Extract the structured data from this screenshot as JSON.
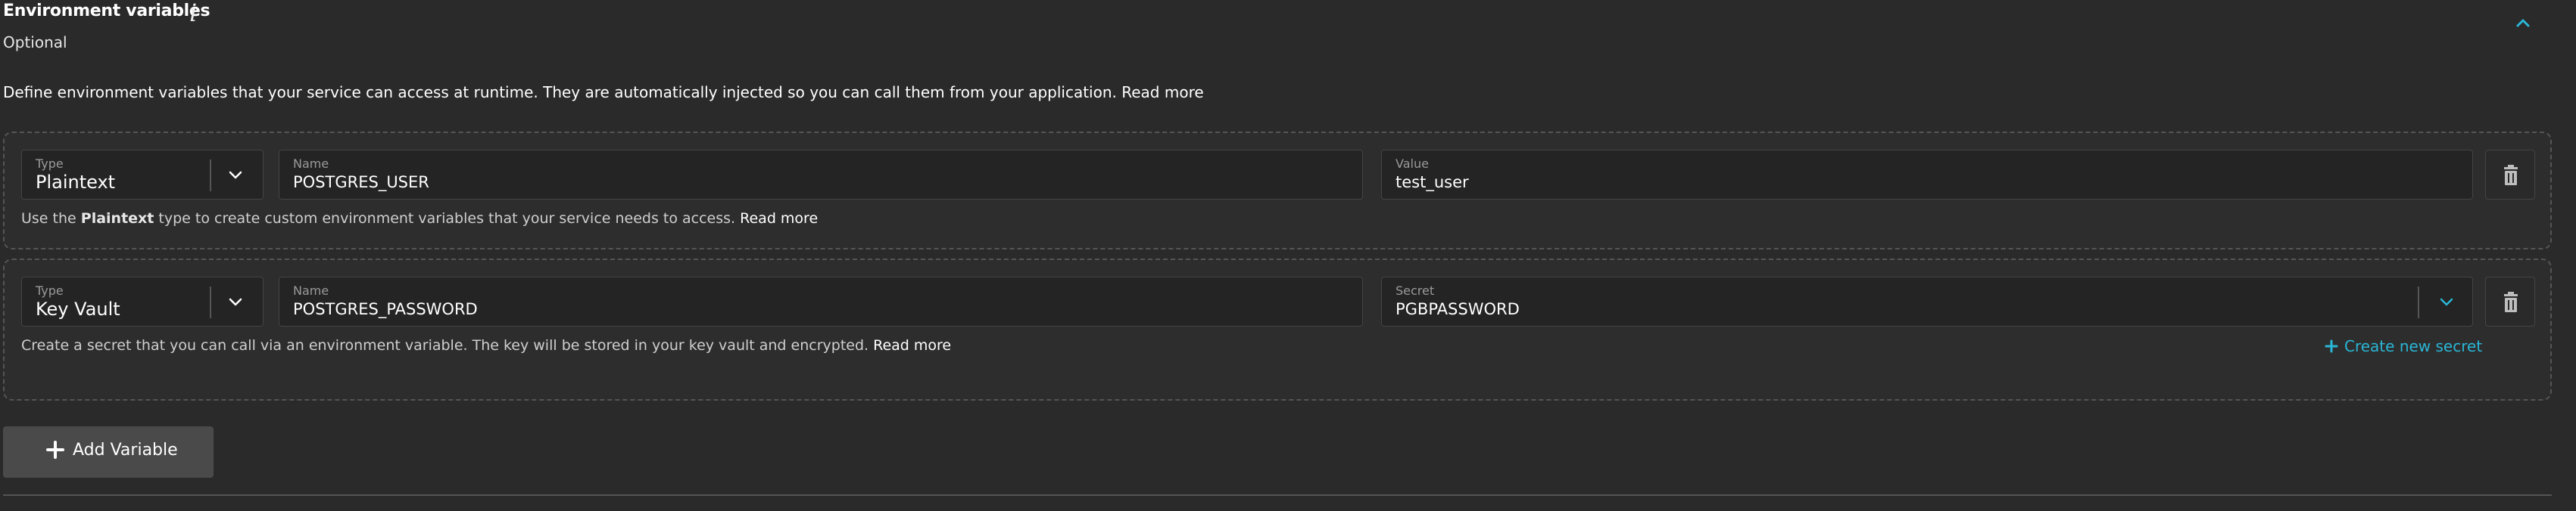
{
  "section": {
    "title": "Environment variables",
    "info_icon": "i",
    "subtitle": "Optional",
    "description": "Define environment variables that your service can access at runtime. They are automatically injected so you can call them from your application. Read more"
  },
  "variables": [
    {
      "type_label": "Type",
      "type_value": "Plaintext",
      "name_label": "Name",
      "name_value": "POSTGRES_USER",
      "value_label": "Value",
      "value_value": "test_user",
      "help_prefix": "Use the ",
      "help_bold": "Plaintext",
      "help_suffix": " type to create custom environment variables that your service needs to access.",
      "help_link": "Read more"
    },
    {
      "type_label": "Type",
      "type_value": "Key Vault",
      "name_label": "Name",
      "name_value": "POSTGRES_PASSWORD",
      "secret_label": "Secret",
      "secret_value": "PGBPASSWORD",
      "help_text": "Create a secret that you can call via an environment variable. The key will be stored in your key vault and encrypted.",
      "help_link": "Read more",
      "create_secret_label": "Create new secret"
    }
  ],
  "add_variable_label": "Add Variable",
  "colors": {
    "accent": "#2ab6d6",
    "background": "#2a2a2a",
    "field": "#242424"
  },
  "icons": [
    "info-icon",
    "chevron-up-icon",
    "chevron-down-icon",
    "trash-icon",
    "plus-icon"
  ]
}
